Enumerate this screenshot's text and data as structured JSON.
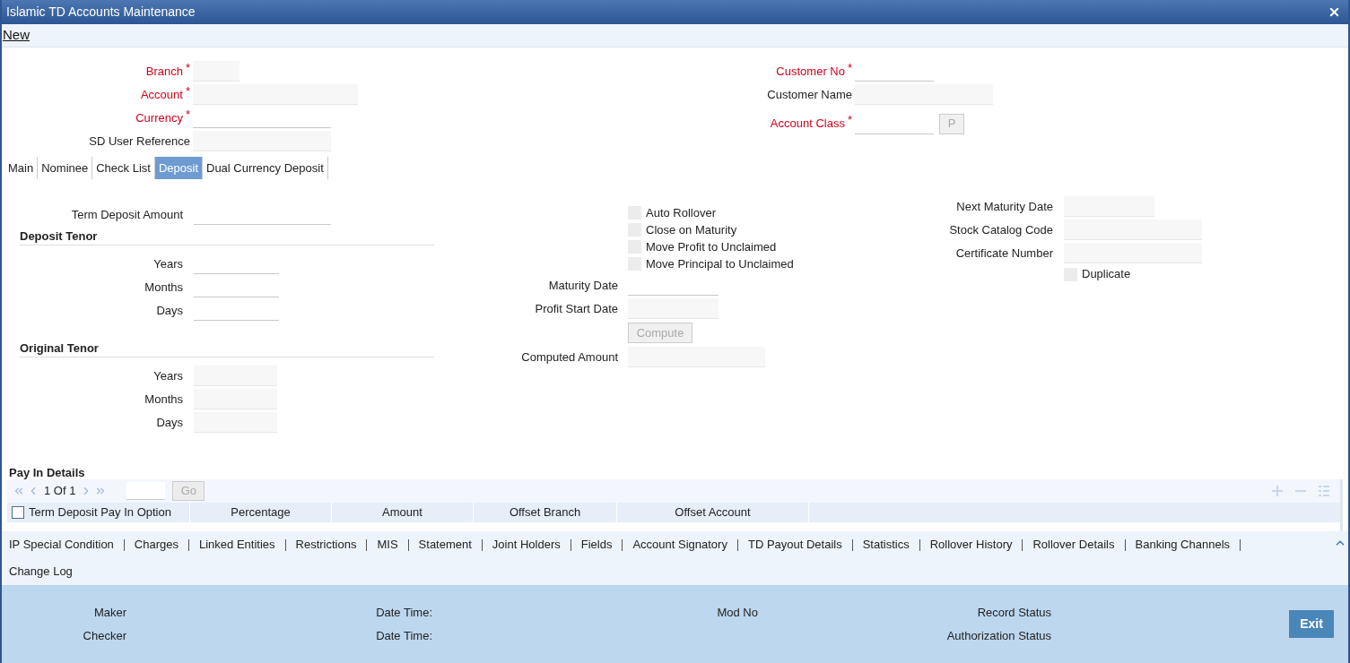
{
  "window": {
    "title": "Islamic TD Accounts Maintenance"
  },
  "menu": [
    {
      "label": "New"
    }
  ],
  "header": {
    "left": [
      {
        "label": "Branch",
        "required": true,
        "marker": "*",
        "kind": "filled"
      },
      {
        "label": "Account",
        "required": true,
        "marker": "*",
        "kind": "filled"
      },
      {
        "label": "Currency",
        "required": true,
        "marker": "*",
        "kind": "line"
      },
      {
        "label": "SD User Reference",
        "required": false,
        "kind": "filled"
      }
    ],
    "right": [
      {
        "label": "Customer No",
        "required": true,
        "marker": "*",
        "kind": "line"
      },
      {
        "label": "Customer Name",
        "required": false,
        "kind": "filled"
      },
      {
        "label": "Account Class",
        "required": true,
        "marker": "*",
        "kind": "line",
        "button": "P"
      }
    ]
  },
  "tabs": [
    {
      "label": "Main",
      "selected": false
    },
    {
      "label": "Nominee",
      "selected": false
    },
    {
      "label": "Check List",
      "selected": false
    },
    {
      "label": "Deposit",
      "selected": true
    },
    {
      "label": "Dual Currency Deposit",
      "selected": false
    }
  ],
  "deposit": {
    "term_deposit_amount": {
      "label": "Term Deposit Amount",
      "kind": "line"
    },
    "sections": [
      {
        "title": "Deposit Tenor",
        "fields": [
          {
            "label": "Years",
            "kind": "line"
          },
          {
            "label": "Months",
            "kind": "line"
          },
          {
            "label": "Days",
            "kind": "line"
          }
        ]
      },
      {
        "title": "Original Tenor",
        "fields": [
          {
            "label": "Years",
            "kind": "filled"
          },
          {
            "label": "Months",
            "kind": "filled"
          },
          {
            "label": "Days",
            "kind": "filled"
          }
        ]
      }
    ],
    "checkboxes": [
      {
        "label": "Auto Rollover",
        "checked": false
      },
      {
        "label": "Close on Maturity",
        "checked": false
      },
      {
        "label": "Move Profit to Unclaimed",
        "checked": false
      },
      {
        "label": "Move Principal to Unclaimed",
        "checked": false
      }
    ],
    "middle_fields": [
      {
        "label": "Maturity Date",
        "kind": "line"
      },
      {
        "label": "Profit Start Date",
        "kind": "filled"
      }
    ],
    "compute_button": "Compute",
    "computed_amount": {
      "label": "Computed Amount",
      "kind": "filled"
    },
    "right_fields": [
      {
        "label": "Next Maturity Date",
        "kind": "filled"
      },
      {
        "label": "Stock Catalog Code",
        "kind": "filled"
      },
      {
        "label": "Certificate Number",
        "kind": "filled"
      }
    ],
    "duplicate": {
      "label": "Duplicate",
      "checked": false
    }
  },
  "pay_in": {
    "title": "Pay In Details",
    "pager": "1 Of 1",
    "go": "Go",
    "select_all": {
      "checked": false
    },
    "columns": [
      "Term Deposit Pay In Option",
      "Percentage",
      "Amount",
      "Offset Branch",
      "Offset Account"
    ]
  },
  "links": [
    "IP Special Condition",
    "Charges",
    "Linked Entities",
    "Restrictions",
    "MIS",
    "Statement",
    "Joint Holders",
    "Fields",
    "Account Signatory",
    "TD Payout Details",
    "Statistics",
    "Rollover History",
    "Rollover Details",
    "Banking Channels",
    "Change Log"
  ],
  "footer": {
    "row1": [
      "Maker",
      "Date Time:",
      "Mod No",
      "Record Status"
    ],
    "row2": [
      "Checker",
      "Date Time:",
      "Authorization Status"
    ],
    "exit": "Exit"
  }
}
